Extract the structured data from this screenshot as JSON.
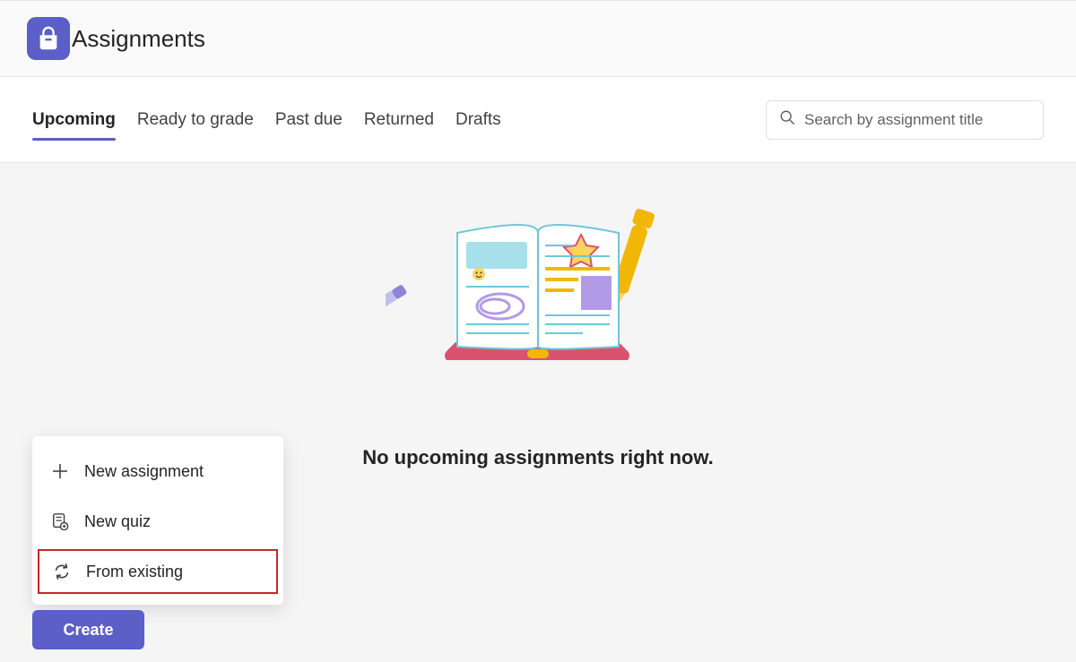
{
  "header": {
    "title": "Assignments"
  },
  "tabs": [
    {
      "label": "Upcoming",
      "active": true
    },
    {
      "label": "Ready to grade",
      "active": false
    },
    {
      "label": "Past due",
      "active": false
    },
    {
      "label": "Returned",
      "active": false
    },
    {
      "label": "Drafts",
      "active": false
    }
  ],
  "search": {
    "placeholder": "Search by assignment title"
  },
  "empty": {
    "message": "No upcoming assignments right now."
  },
  "createMenu": {
    "items": [
      {
        "label": "New assignment",
        "icon": "plus-icon"
      },
      {
        "label": "New quiz",
        "icon": "quiz-icon"
      },
      {
        "label": "From existing",
        "icon": "refresh-icon",
        "highlighted": true
      }
    ],
    "buttonLabel": "Create"
  },
  "colors": {
    "accent": "#5b5fc7",
    "highlight": "#c72828"
  }
}
